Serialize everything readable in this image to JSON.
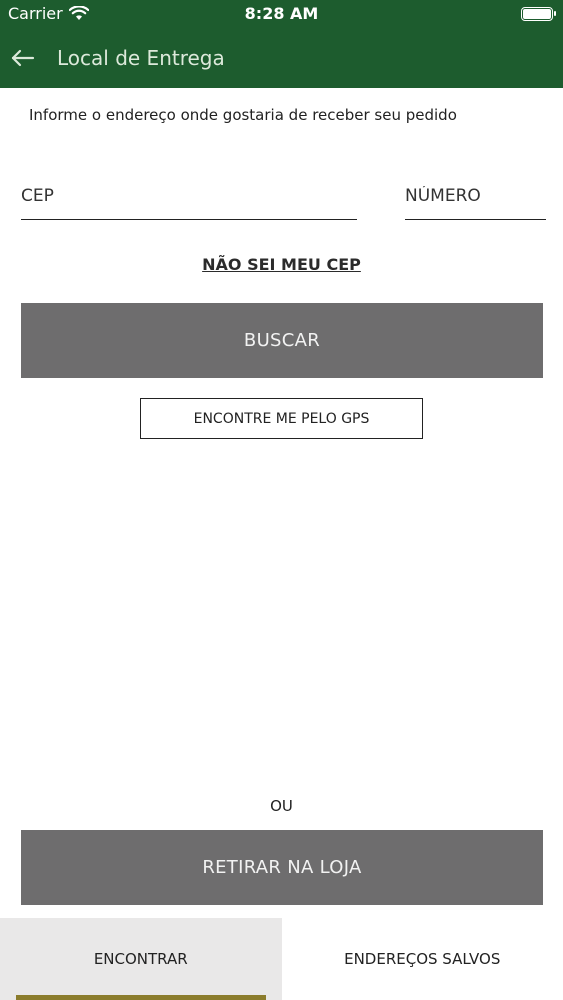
{
  "status_bar": {
    "carrier": "Carrier",
    "time": "8:28 AM",
    "icons": [
      "wifi-icon",
      "battery-icon"
    ]
  },
  "header": {
    "title": "Local de Entrega",
    "back_icon": "arrow-left-icon"
  },
  "form": {
    "intro": "Informe o endereço onde gostaria de receber seu pedido",
    "cep_placeholder": "CEP",
    "numero_placeholder": "NÚMERO",
    "nao_sei_cep_link": "NÃO SEI MEU CEP",
    "buscar_button": "BUSCAR",
    "gps_button": "ENCONTRE ME PELO GPS"
  },
  "pickup": {
    "separator": "OU",
    "retirar_button": "RETIRAR NA LOJA"
  },
  "tabs": [
    {
      "label": "ENCONTRAR",
      "active": true
    },
    {
      "label": "ENDEREÇOS SALVOS",
      "active": false
    }
  ],
  "colors": {
    "header_bg": "#1d5c2e",
    "button_gray": "#6e6d6e",
    "tab_indicator": "#8b7c2c",
    "active_tab_bg": "#e9e8e8"
  }
}
